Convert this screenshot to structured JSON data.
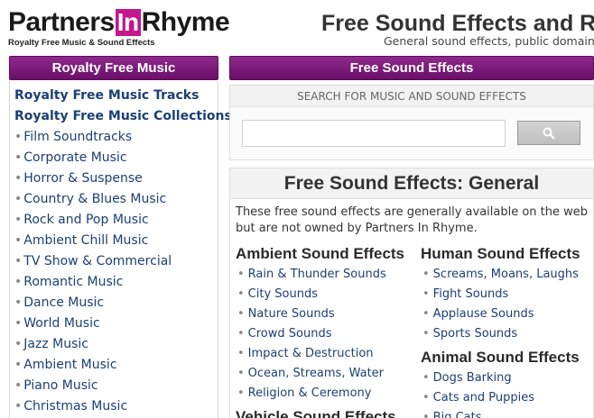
{
  "header": {
    "logo_part1": "Partners",
    "logo_in": "In",
    "logo_part2": "Rhyme",
    "logo_tagline": "Royalty Free Music & Sound Effects",
    "site_title": "Free Sound Effects and R",
    "site_subtitle": "General sound effects, public domain so"
  },
  "colors": {
    "accent_purple": "#7a1a7a",
    "logo_magenta": "#c4168f",
    "link_blue": "#1b3f74"
  },
  "sidebar": {
    "bar_title": "Royalty Free Music",
    "bold_links": [
      "Royalty Free Music Tracks",
      "Royalty Free Music Collections"
    ],
    "links": [
      "Film Soundtracks",
      "Corporate Music",
      "Horror & Suspense",
      "Country & Blues Music",
      "Rock and Pop Music",
      "Ambient Chill Music",
      "TV Show & Commercial",
      "Romantic Music",
      "Dance Music",
      "World Music",
      "Jazz Music",
      "Ambient Music",
      "Piano Music",
      "Christmas Music"
    ]
  },
  "main_bar": {
    "title": "Free Sound Effects"
  },
  "search": {
    "header": "SEARCH FOR MUSIC AND SOUND EFFECTS",
    "value": "",
    "button_icon": "search-icon"
  },
  "content": {
    "title": "Free Sound Effects: General",
    "intro": "These free sound effects are generally available on the web but are not owned by Partners In Rhyme.",
    "ambient": {
      "heading": "Ambient Sound Effects",
      "items": [
        "Rain & Thunder Sounds",
        "City Sounds",
        "Nature Sounds",
        "Crowd Sounds",
        "Impact & Destruction",
        "Ocean, Streams, Water",
        "Religion & Ceremony"
      ]
    },
    "vehicle": {
      "heading": "Vehicle Sound Effects"
    },
    "human": {
      "heading": "Human Sound Effects",
      "items": [
        "Screams, Moans, Laughs",
        "Fight Sounds",
        "Applause Sounds",
        "Sports Sounds"
      ]
    },
    "animal": {
      "heading": "Animal Sound Effects",
      "items": [
        "Dogs Barking",
        "Cats and Puppies",
        "Big Cats"
      ]
    }
  }
}
